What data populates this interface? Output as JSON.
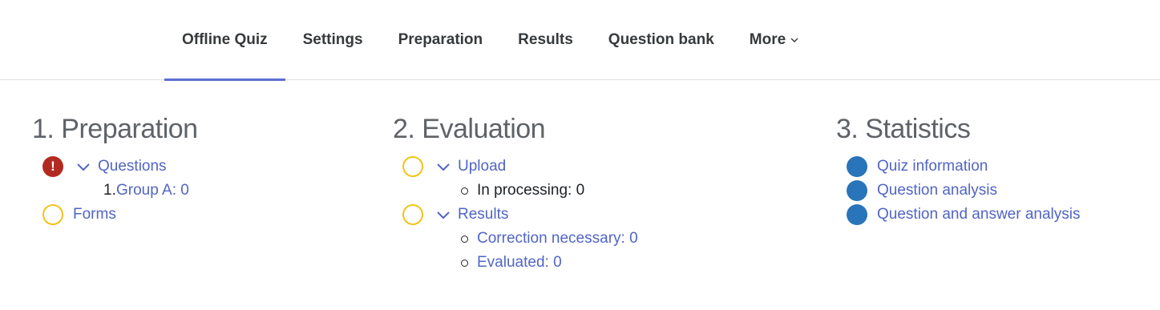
{
  "tabs": [
    {
      "label": "Offline Quiz",
      "active": true
    },
    {
      "label": "Settings"
    },
    {
      "label": "Preparation"
    },
    {
      "label": "Results"
    },
    {
      "label": "Question bank"
    },
    {
      "label": "More"
    }
  ],
  "colors": {
    "accent": "#5b6fd0",
    "link": "#5165c4",
    "todo": "#f0c419",
    "error": "#b32a22",
    "done": "#2a74b9"
  },
  "preparation": {
    "heading": "1. Preparation",
    "questions_label": "Questions",
    "group_number": "1.",
    "group_label": "Group A: 0",
    "forms_label": "Forms"
  },
  "evaluation": {
    "heading": "2. Evaluation",
    "upload_label": "Upload",
    "in_processing": "In processing: 0",
    "results_label": "Results",
    "correction_necessary": "Correction necessary: 0",
    "evaluated": "Evaluated: 0"
  },
  "statistics": {
    "heading": "3. Statistics",
    "items": [
      {
        "label": "Quiz information"
      },
      {
        "label": "Question analysis"
      },
      {
        "label": "Question and answer analysis"
      }
    ]
  }
}
